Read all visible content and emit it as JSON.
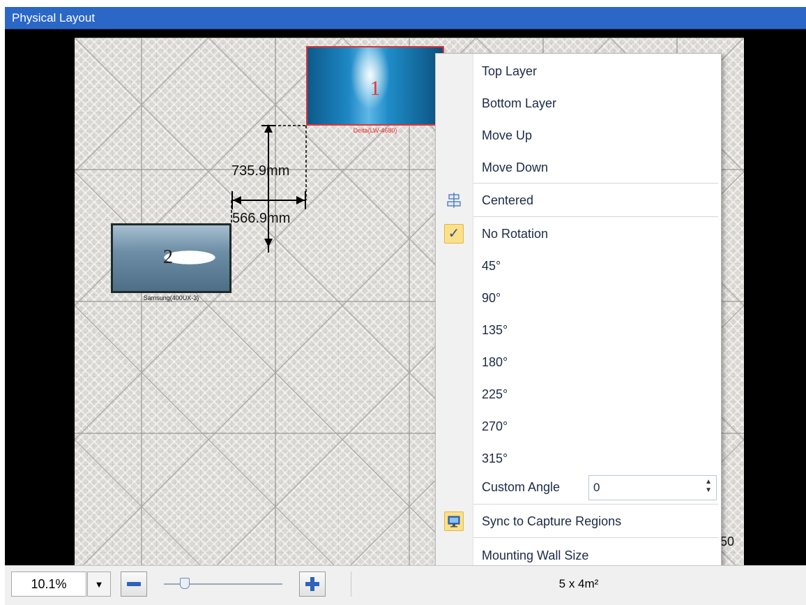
{
  "window": {
    "title": "Physical Layout"
  },
  "displays": [
    {
      "number": "1",
      "caption": "Delta(LW-4680)",
      "selected": true,
      "border_color": "#e83232"
    },
    {
      "number": "2",
      "caption": "Samsung(400UX-3)",
      "selected": false,
      "border_color": "#1f2a2a"
    }
  ],
  "measurements": {
    "height": "735.9mm",
    "width": "566.9mm"
  },
  "scale_label": "50",
  "context_menu": {
    "top_layer": "Top Layer",
    "bottom_layer": "Bottom Layer",
    "move_up": "Move Up",
    "move_down": "Move Down",
    "centered": "Centered",
    "no_rotation": "No Rotation",
    "r45": "45°",
    "r90": "90°",
    "r135": "135°",
    "r180": "180°",
    "r225": "225°",
    "r270": "270°",
    "r315": "315°",
    "custom_angle": "Custom Angle",
    "custom_angle_value": "0",
    "sync": "Sync to Capture Regions",
    "mounting_wall": "Mounting Wall Size",
    "checked_item": "no_rotation"
  },
  "toolbar": {
    "zoom": "10.1%",
    "wall_area": "5 x 4m²"
  },
  "colors": {
    "title_bar": "#2a67c6",
    "selection": "#e83232",
    "menu_check": "#fbe08a"
  }
}
